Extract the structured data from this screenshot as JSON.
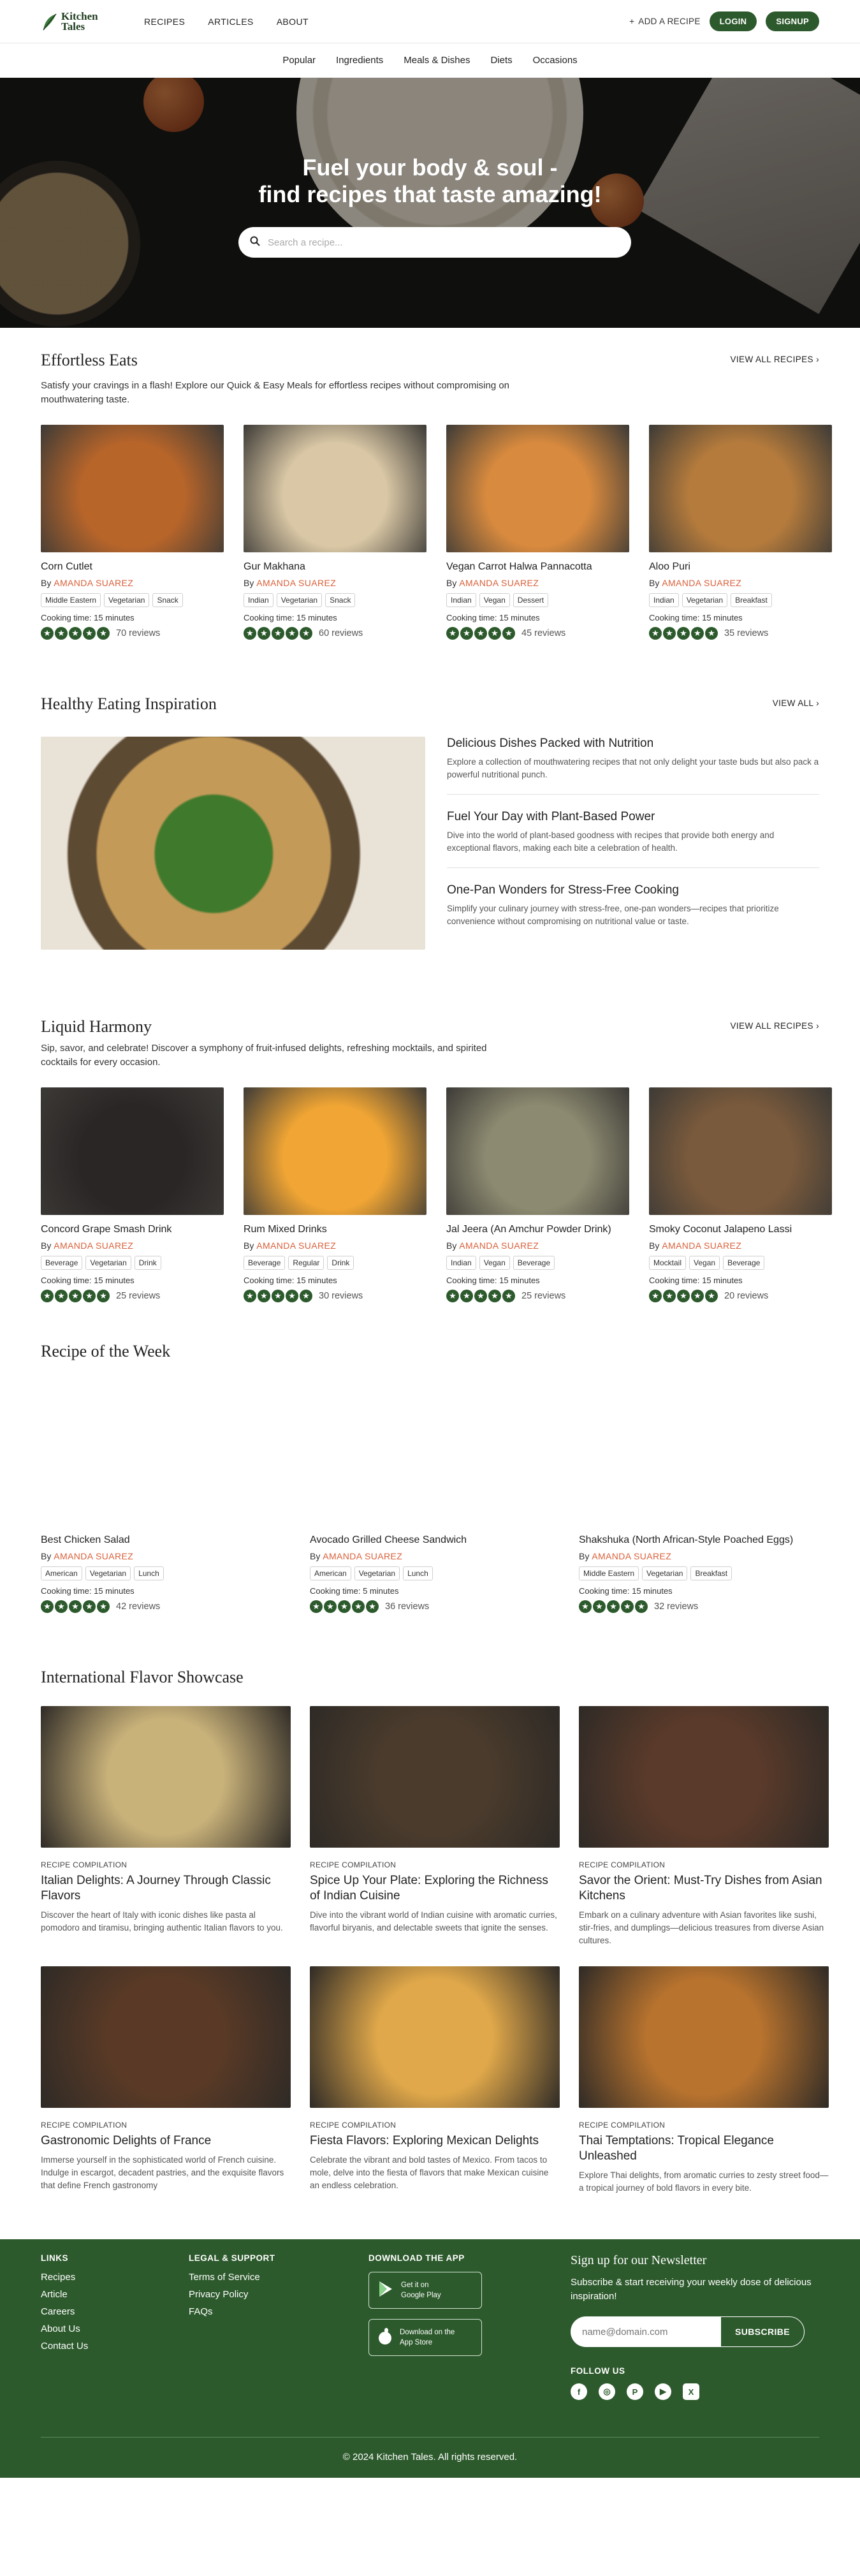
{
  "brand": {
    "line1": "Kitchen",
    "line2": "Tales"
  },
  "nav": {
    "recipes": "RECIPES",
    "articles": "ARTICLES",
    "about": "ABOUT",
    "add": "ADD A RECIPE",
    "login": "LOGIN",
    "signup": "SIGNUP"
  },
  "subnav": [
    "Popular",
    "Ingredients",
    "Meals & Dishes",
    "Diets",
    "Occasions"
  ],
  "hero": {
    "line1": "Fuel your body & soul -",
    "line2": "find recipes that taste amazing!",
    "placeholder": "Search a recipe..."
  },
  "effortless": {
    "title": "Effortless Eats",
    "view_all": "VIEW ALL RECIPES",
    "desc": "Satisfy your cravings in a flash! Explore our Quick & Easy Meals for effortless recipes without compromising on mouthwatering taste.",
    "cards": [
      {
        "name": "Corn Cutlet",
        "author": "AMANDA SUAREZ",
        "tags": [
          "Middle Eastern",
          "Vegetarian",
          "Snack"
        ],
        "time": "Cooking time: 15 minutes",
        "reviews": "70 reviews",
        "color": "#b8652a"
      },
      {
        "name": "Gur Makhana",
        "author": "AMANDA SUAREZ",
        "tags": [
          "Indian",
          "Vegetarian",
          "Snack"
        ],
        "time": "Cooking time: 15 minutes",
        "reviews": "60 reviews",
        "color": "#d9c7a5"
      },
      {
        "name": "Vegan Carrot Halwa Pannacotta",
        "author": "AMANDA SUAREZ",
        "tags": [
          "Indian",
          "Vegan",
          "Dessert"
        ],
        "time": "Cooking time: 15 minutes",
        "reviews": "45 reviews",
        "color": "#d88a3e"
      },
      {
        "name": "Aloo Puri",
        "author": "AMANDA SUAREZ",
        "tags": [
          "Indian",
          "Vegetarian",
          "Breakfast"
        ],
        "time": "Cooking time: 15 minutes",
        "reviews": "35 reviews",
        "color": "#b57b3c"
      }
    ]
  },
  "inspiration": {
    "title": "Healthy Eating Inspiration",
    "view_all": "VIEW ALL",
    "items": [
      {
        "title": "Delicious Dishes Packed with Nutrition",
        "text": "Explore a collection of mouthwatering recipes that not only delight your taste buds but also pack a powerful nutritional punch."
      },
      {
        "title": "Fuel Your Day with Plant-Based Power",
        "text": "Dive into the world of plant-based goodness with recipes that provide both energy and exceptional flavors, making each bite a celebration of health."
      },
      {
        "title": "One-Pan Wonders for Stress-Free Cooking",
        "text": "Simplify your culinary journey with stress-free, one-pan wonders—recipes that prioritize convenience without compromising on nutritional value or taste."
      }
    ]
  },
  "liquid": {
    "title": "Liquid Harmony",
    "view_all": "VIEW ALL RECIPES",
    "desc": "Sip, savor, and celebrate! Discover a symphony of fruit-infused delights, refreshing mocktails, and spirited cocktails for every occasion.",
    "cards": [
      {
        "name": "Concord Grape Smash Drink",
        "author": "AMANDA SUAREZ",
        "tags": [
          "Beverage",
          "Vegetarian",
          "Drink"
        ],
        "time": "Cooking time: 15 minutes",
        "reviews": "25 reviews",
        "color": "#2a2626"
      },
      {
        "name": "Rum Mixed Drinks",
        "author": "AMANDA SUAREZ",
        "tags": [
          "Beverage",
          "Regular",
          "Drink"
        ],
        "time": "Cooking time: 15 minutes",
        "reviews": "30 reviews",
        "color": "#f0a534"
      },
      {
        "name": "Jal Jeera (An Amchur Powder Drink)",
        "author": "AMANDA SUAREZ",
        "tags": [
          "Indian",
          "Vegan",
          "Beverage"
        ],
        "time": "Cooking time: 15 minutes",
        "reviews": "25 reviews",
        "color": "#8c8a70"
      },
      {
        "name": "Smoky Coconut Jalapeno Lassi",
        "author": "AMANDA SUAREZ",
        "tags": [
          "Mocktail",
          "Vegan",
          "Beverage"
        ],
        "time": "Cooking time: 15 minutes",
        "reviews": "20 reviews",
        "color": "#7a5a3c"
      }
    ]
  },
  "week": {
    "title": "Recipe of the Week",
    "cards": [
      {
        "name": "Best Chicken Salad",
        "author": "AMANDA SUAREZ",
        "tags": [
          "American",
          "Vegetarian",
          "Lunch"
        ],
        "time": "Cooking time: 15 minutes",
        "reviews": "42 reviews"
      },
      {
        "name": "Avocado Grilled Cheese Sandwich",
        "author": "AMANDA SUAREZ",
        "tags": [
          "American",
          "Vegetarian",
          "Lunch"
        ],
        "time": "Cooking time: 5 minutes",
        "reviews": "36 reviews"
      },
      {
        "name": "Shakshuka (North African-Style Poached Eggs)",
        "author": "AMANDA SUAREZ",
        "tags": [
          "Middle Eastern",
          "Vegetarian",
          "Breakfast"
        ],
        "time": "Cooking time: 15 minutes",
        "reviews": "32 reviews"
      }
    ]
  },
  "showcase": {
    "title": "International Flavor Showcase",
    "cards": [
      {
        "kicker": "RECIPE COMPILATION",
        "title": "Italian Delights: A Journey Through Classic Flavors",
        "text": "Discover the heart of Italy with iconic dishes like pasta al pomodoro and tiramisu, bringing authentic Italian flavors to you.",
        "color": "#c9b27a"
      },
      {
        "kicker": "RECIPE COMPILATION",
        "title": "Spice Up Your Plate: Exploring the Richness of Indian Cuisine",
        "text": "Dive into the vibrant world of Indian cuisine with aromatic curries, flavorful biryanis, and delectable sweets that ignite the senses.",
        "color": "#4a3b2c"
      },
      {
        "kicker": "RECIPE COMPILATION",
        "title": "Savor the Orient: Must-Try Dishes from Asian Kitchens",
        "text": "Embark on a culinary adventure with Asian favorites like sushi, stir-fries, and dumplings—delicious treasures from diverse Asian cultures.",
        "color": "#5a3a2a"
      },
      {
        "kicker": "RECIPE COMPILATION",
        "title": "Gastronomic Delights of France",
        "text": "Immerse yourself in the sophisticated world of French cuisine. Indulge in escargot, decadent pastries, and the exquisite flavors that define French gastronomy",
        "color": "#5a3a26"
      },
      {
        "kicker": "RECIPE COMPILATION",
        "title": "Fiesta Flavors: Exploring Mexican Delights",
        "text": "Celebrate the vibrant and bold tastes of Mexico. From tacos to mole, delve into the fiesta of flavors that make Mexican cuisine an endless celebration.",
        "color": "#e0a84a"
      },
      {
        "kicker": "RECIPE COMPILATION",
        "title": "Thai Temptations: Tropical Elegance Unleashed",
        "text": "Explore Thai delights, from aromatic curries to zesty street food—a tropical journey of bold flavors in every bite.",
        "color": "#b8732e"
      }
    ]
  },
  "footer": {
    "links_title": "LINKS",
    "links": [
      "Recipes",
      "Article",
      "Careers",
      "About Us",
      "Contact Us"
    ],
    "legal_title": "LEGAL & SUPPORT",
    "legal": [
      "Terms of Service",
      "Privacy Policy",
      "FAQs"
    ],
    "app_title": "DOWNLOAD THE APP",
    "gplay_small": "Get it on",
    "gplay_big": "Google Play",
    "appstore_small": "Download on the",
    "appstore_big": "App Store",
    "nl_title": "Sign up for our Newsletter",
    "nl_text": "Subscribe & start receiving your weekly dose of delicious inspiration!",
    "nl_placeholder": "name@domain.com",
    "nl_button": "SUBSCRIBE",
    "follow": "FOLLOW US",
    "copyright": "© 2024 Kitchen Tales. All rights reserved."
  },
  "colors": {
    "brand_green": "#2d5a2d",
    "author_orange": "#d9603a"
  }
}
